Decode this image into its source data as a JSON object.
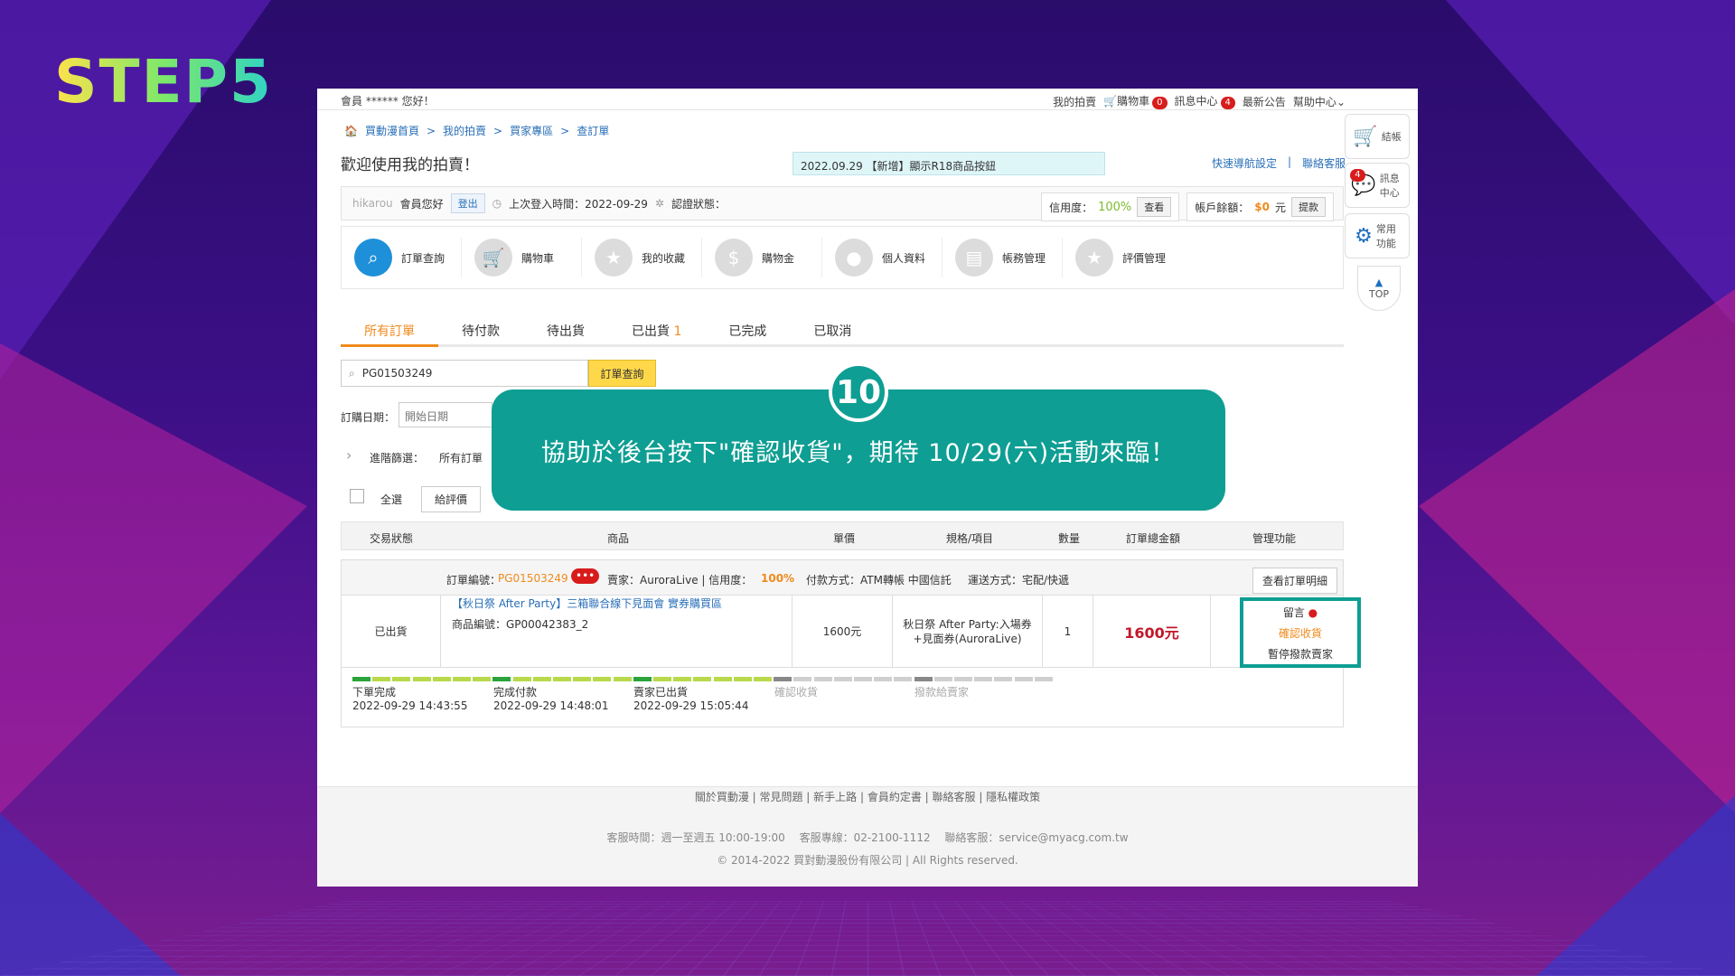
{
  "step_label": "STEP5",
  "topbar": {
    "greeting": "會員 ****** 您好！",
    "my_auction": "我的拍賣",
    "cart": "購物車",
    "cart_count": "0",
    "msg": "訊息中心",
    "msg_count": "4",
    "news": "最新公告",
    "help": "幫助中心"
  },
  "breadcrumb": [
    "買動漫首頁",
    ">",
    "我的拍賣",
    ">",
    "買家專區",
    ">",
    "查訂單"
  ],
  "welcome": "歡迎使用我的拍賣！",
  "notice": "2022.09.29 【新增】顯示R18商品按鈕",
  "top_links": [
    "快速導航設定",
    "|",
    "聯絡客服"
  ],
  "user": {
    "name": "hikarou",
    "suffix": "會員您好",
    "logout": "登出",
    "last_login": "上次登入時間：2022-09-29",
    "verify": "認證狀態：",
    "credit_label": "信用度：",
    "credit_value": "100%",
    "view": "查看",
    "balance_label": "帳戶餘額：",
    "balance_value": "$0",
    "unit": "元",
    "withdraw": "提款"
  },
  "nav": [
    {
      "label": "訂單查詢",
      "icon": "search-icon"
    },
    {
      "label": "購物車",
      "icon": "cart-icon"
    },
    {
      "label": "我的收藏",
      "icon": "star-icon"
    },
    {
      "label": "購物金",
      "icon": "dollar-icon"
    },
    {
      "label": "個人資料",
      "icon": "user-icon"
    },
    {
      "label": "帳務管理",
      "icon": "wallet-icon"
    },
    {
      "label": "評價管理",
      "icon": "star-icon"
    }
  ],
  "tabs": [
    {
      "label": "所有訂單"
    },
    {
      "label": "待付款"
    },
    {
      "label": "待出貨"
    },
    {
      "label": "已出貨",
      "count": "1"
    },
    {
      "label": "已完成"
    },
    {
      "label": "已取消"
    }
  ],
  "search": {
    "value": "PG01503249",
    "button": "訂單查詢"
  },
  "filters": {
    "date_label": "訂購日期：",
    "date_placeholder": "開始日期",
    "advanced_label": "進階篩選：",
    "advanced_value": "所有訂單",
    "select_all": "全選",
    "review_btn": "給評價"
  },
  "overlay": {
    "number": "10",
    "text": "協助於後台按下\"確認收貨\"，期待 10/29(六)活動來臨！"
  },
  "table_headers": [
    "交易狀態",
    "商品",
    "單價",
    "規格/項目",
    "數量",
    "訂單總金額",
    "管理功能"
  ],
  "order": {
    "no_label": "訂單編號：",
    "no": "PG01503249",
    "seller": "賣家：AuroraLive | 信用度：",
    "seller_credit": "100%",
    "payment": "付款方式：ATM轉帳 中國信託",
    "shipping": "運送方式：宅配/快遞",
    "detail_btn": "查看訂單明細"
  },
  "row": {
    "status": "已出貨",
    "product": "【秋日祭 After Party】三箱聯合線下見面會 實券購買區",
    "product_no": "商品編號：GP00042383_2",
    "price": "1600元",
    "spec": "秋日祭 After Party:入場券+見面券(AuroraLive)",
    "qty": "1",
    "total": "1600元",
    "msg": "留言",
    "confirm": "確認收貨",
    "pay_seller": "暫停撥款賣家"
  },
  "progress": [
    {
      "label": "下單完成",
      "time": "2022-09-29 14:43:55"
    },
    {
      "label": "完成付款",
      "time": "2022-09-29 14:48:01"
    },
    {
      "label": "賣家已出貨",
      "time": "2022-09-29 15:05:44"
    },
    {
      "label": "確認收貨",
      "time": ""
    },
    {
      "label": "撥款給賣家",
      "time": ""
    }
  ],
  "footer": {
    "links": "關於買動漫 | 常見問題 | 新手上路 | 會員約定書 | 聯絡客服 | 隱私權政策",
    "service": "客服時間：週一至週五 10:00-19:00　 客服專線：02-2100-1112　 聯絡客服：service@myacg.com.tw",
    "copyright": "© 2014-2022 買對動漫股份有限公司 | All Rights reserved."
  },
  "sidebar": {
    "checkout": "結帳",
    "msg": "訊息中心",
    "msg_count": "4",
    "common": "常用功能",
    "top": "TOP"
  },
  "colors": {
    "accent": "#f08a1c",
    "teal": "#0e9e93",
    "blue": "#1e90d9",
    "red": "#d81c1c"
  }
}
